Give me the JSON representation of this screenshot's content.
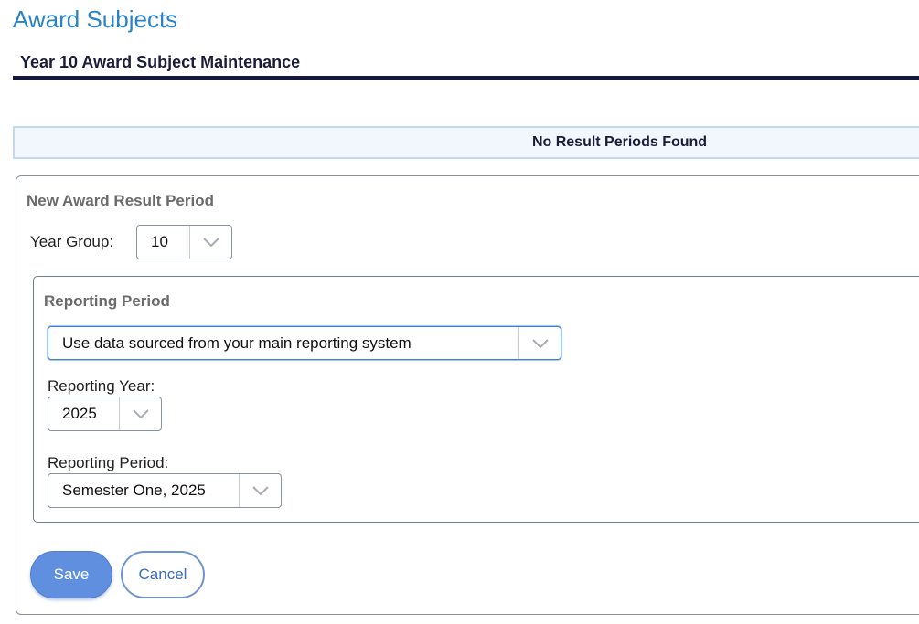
{
  "page": {
    "title": "Award Subjects",
    "section_heading": "Year 10 Award Subject Maintenance"
  },
  "notice": {
    "text": "No Result Periods Found"
  },
  "new_period_panel": {
    "legend": "New Award Result Period",
    "year_group": {
      "label": "Year Group:",
      "value": "10"
    },
    "reporting_period_panel": {
      "legend": "Reporting Period",
      "source_select": {
        "value": "Use data sourced from your main reporting system"
      },
      "reporting_year": {
        "label": "Reporting Year:",
        "value": "2025"
      },
      "reporting_period": {
        "label": "Reporting Period:",
        "value": "Semester One, 2025"
      }
    },
    "buttons": {
      "save": "Save",
      "cancel": "Cancel"
    }
  },
  "colors": {
    "title": "#2a83c6",
    "heading_rule": "#16183e",
    "notice_background": "#f1f7fd",
    "save_button": "#5f8fde",
    "cancel_border": "#6f95cf"
  },
  "icons": {
    "select_arrow": "chevron-down-icon"
  }
}
